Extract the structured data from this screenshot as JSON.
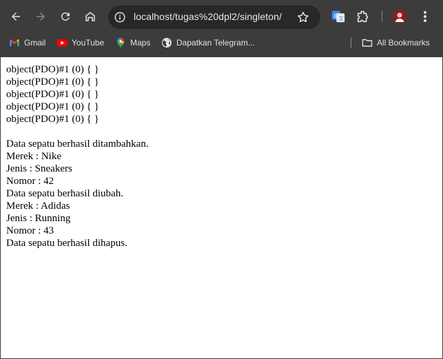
{
  "browser": {
    "url": "localhost/tugas%20dpl2/singleton/",
    "bookmarks": [
      {
        "label": "Gmail",
        "icon": "gmail-icon"
      },
      {
        "label": "YouTube",
        "icon": "youtube-icon"
      },
      {
        "label": "Maps",
        "icon": "maps-icon"
      },
      {
        "label": "Dapatkan Telegram...",
        "icon": "globe-icon"
      }
    ],
    "all_bookmarks_label": "All Bookmarks",
    "colors": {
      "chrome_bg": "#3c3c3c",
      "omnibox_bg": "#282828",
      "text": "#e3e3e3"
    }
  },
  "page": {
    "pdo_lines": [
      "object(PDO)#1 (0) { }",
      "object(PDO)#1 (0) { }",
      "object(PDO)#1 (0) { }",
      "object(PDO)#1 (0) { }",
      "object(PDO)#1 (0) { }"
    ],
    "messages": [
      "Data sepatu berhasil ditambahkan.",
      "Merek : Nike",
      "Jenis : Sneakers",
      "Nomor : 42",
      "Data sepatu berhasil diubah.",
      "Merek : Adidas",
      "Jenis : Running",
      "Nomor : 43",
      "Data sepatu berhasil dihapus."
    ]
  }
}
